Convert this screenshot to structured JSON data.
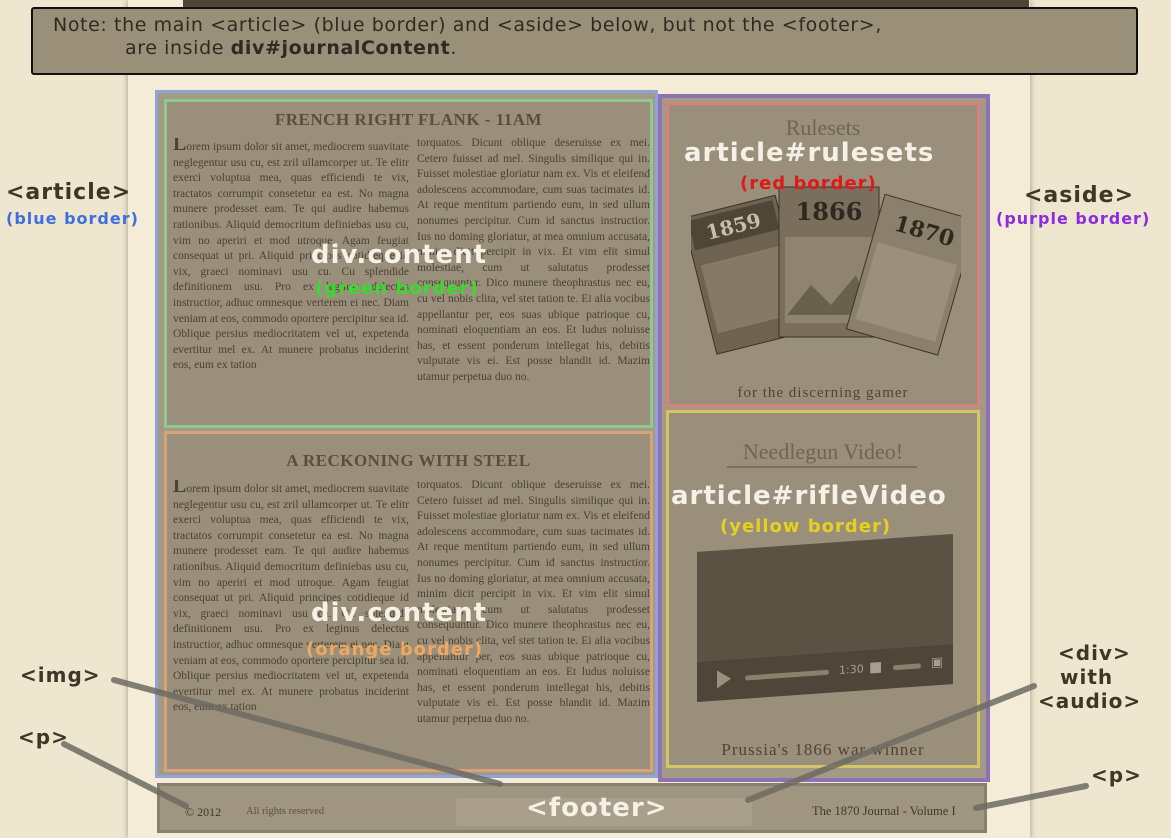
{
  "note": {
    "line1": "Note: the main <article> (blue border) and <aside> below, but not the <footer>,",
    "line2_pre": "are inside ",
    "line2_bold": "div#journalContent",
    "line2_post": "."
  },
  "main": {
    "content1": {
      "headline": "FRENCH RIGHT FLANK - 11AM",
      "col1_drop": "L",
      "col1": "orem ipsum dolor sit amet, mediocrem suavitate neglegentur usu cu, est zril ullamcorper ut. Te elitr exerci voluptua mea, quas efficiendi te vix, tractatos corrumpit consetetur ea est. No magna munere prodesset eam. Te qui audire habemus rationibus. Aliquid democritum definiebas usu cu, vim no aperiri et mod utroque. Agam feugiat consequat ut pri. Aliquid principes cotidieque id vix, graeci nominavi usu cu. Cu splendide definitionem usu. Pro ex leginus delectus instructior, adhuc omnesque verterem ei nec. Diam veniam at eos, commodo oportere percipitur sea id. Oblique persius mediocritatem vel ut, expetenda evertitur mel ex. At munere probatus inciderint eos, eum ex tation",
      "col2": "torquatos. Dicunt oblique deseruisse ex mei. Cetero fuisset ad mel. Singulis similique qui in. Fuisset molestiae gloriatur nam ex. Vis et eleifend adolescens accommodare, cum suas tacimates id. At reque mentitum partiendo eum, in sed ullum nonumes percipitur. Cum id sanctus instructior. Ius no doming gloriatur, at mea omnium accusata, minim dicit percipit in vix. Et vim elit simul molestiae, cum ut salutatus prodesset consequuntur. Dico munere theophrastus nec eu, cu vel nobis clita, vel stet tation te. Ei alia vocibus appellantur per, eos suas ubique patrioque cu, nominati eloquentiam an eos. Et ludus noluisse has, et essent ponderum intellegat his, debitis vulputate vis ei. Est posse blandit id. Mazim utamur perpetua duo no."
    },
    "content2": {
      "headline": "A RECKONING WITH STEEL",
      "col1_drop": "L",
      "col1": "orem ipsum dolor sit amet, mediocrem suavitate neglegentur usu cu, est zril ullamcorper ut. Te elitr exerci voluptua mea, quas efficiendi te vix, tractatos corrumpit consetetur ea est. No magna munere prodesset eam. Te qui audire habemus rationibus. Aliquid democritum definiebas usu cu, vim no aperiri et mod utroque. Agam feugiat consequat ut pri. Aliquid principes cotidieque id vix, graeci nominavi usu cu. Cu splendide definitionem usu. Pro ex leginus delectus instructior, adhuc omnesque verterem ei nec. Diam veniam at eos, commodo oportere percipitur sea id. Oblique persius mediocritatem vel ut, expetenda evertitur mel ex. At munere probatus inciderint eos, eum ex tation",
      "col2": "torquatos. Dicunt oblique deseruisse ex mei. Cetero fuisset ad mel. Singulis similique qui in. Fuisset molestiae gloriatur nam ex. Vis et eleifend adolescens accommodare, cum suas tacimates id. At reque mentitum partiendo eum, in sed ullum nonumes percipitur. Cum id sanctus instructior. Ius no doming gloriatur, at mea omnium accusata, minim dicit percipit in vix. Et vim elit simul molestiae, cum ut salutatus prodesset consequuntur. Dico munere theophrastus nec eu, cu vel nobis clita, vel stet tation te. Ei alia vocibus appellantur per, eos suas ubique patrioque cu, nominati eloquentiam an eos. Et ludus noluisse has, et essent ponderum intellegat his, debitis vulputate vis ei. Est posse blandit id. Mazim utamur perpetua duo no."
    }
  },
  "aside": {
    "rulesets": {
      "title": "Rulesets",
      "caption": "for the discerning gamer",
      "boxes": [
        "1859",
        "1866",
        "1870"
      ]
    },
    "rifleVideo": {
      "title": "Needlegun Video!",
      "caption": "Prussia's 1866 war winner",
      "time": "1:30"
    }
  },
  "footer": {
    "copyright": "© 2012",
    "rights": "All rights reserved",
    "volume": "The 1870 Journal - Volume I"
  },
  "labels": {
    "article": "<article>",
    "article_sub": "(blue border)",
    "aside": "<aside>",
    "aside_sub": "(purple border)",
    "content1": "div.content",
    "content1_sub": "(green border)",
    "content2": "div.content",
    "content2_sub": "(orange border)",
    "rulesets": "article#rulesets",
    "rulesets_sub": "(red border)",
    "rifleVideo": "article#rifleVideo",
    "rifleVideo_sub": "(yellow border)",
    "img": "<img>",
    "p_left": "<p>",
    "p_right": "<p>",
    "footer": "<footer>",
    "div_audio_1": "<div>",
    "div_audio_2": "with",
    "div_audio_3": "<audio>"
  },
  "colors": {
    "blue": "#3d6fe0",
    "purple": "#8a2be2",
    "green": "#3adb2e",
    "orange": "#f0a860",
    "red": "#e01818",
    "yellow": "#e6d21e"
  }
}
